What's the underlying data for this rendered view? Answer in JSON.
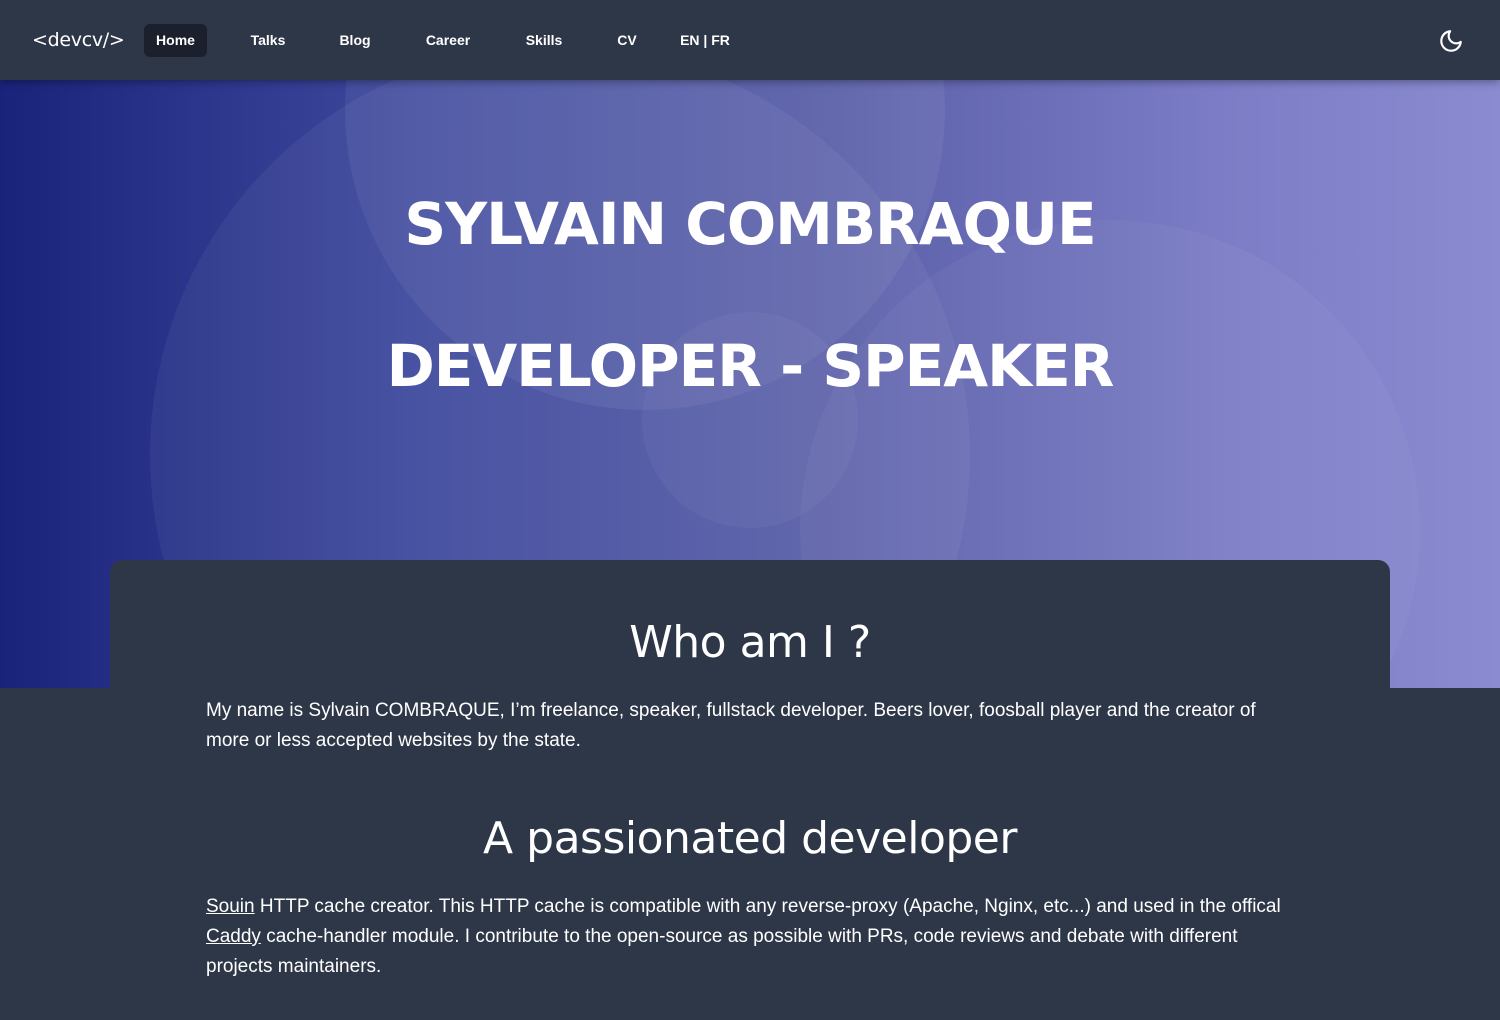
{
  "header": {
    "logo": "<devcv/>",
    "nav": [
      {
        "label": "Home",
        "active": true
      },
      {
        "label": "Talks"
      },
      {
        "label": "Blog"
      },
      {
        "label": "Career"
      },
      {
        "label": "Skills"
      },
      {
        "label": "CV"
      },
      {
        "label": "EN | FR"
      }
    ],
    "theme_icon": "moon-icon"
  },
  "hero": {
    "title_line1": "SYLVAIN COMBRAQUE",
    "title_line2": "DEVELOPER - SPEAKER"
  },
  "about": {
    "title": "Who am I ?",
    "text": "My name is Sylvain COMBRAQUE, I’m freelance, speaker, fullstack developer. Beers lover, foosball player and the creator of more or less accepted websites by the state."
  },
  "passion": {
    "title": "A passionated developer",
    "link_souin": "Souin",
    "text_part1": " HTTP cache creator. This HTTP cache is compatible with any reverse-proxy (Apache, Nginx, etc...) and used in the offical ",
    "link_caddy": "Caddy",
    "text_part2": " cache-handler module. I contribute to the open-source as possible with PRs, code reviews and debate with different projects maintainers."
  },
  "colors": {
    "background": "#2e3748",
    "active_nav": "#1b202c",
    "hero_start": "#1a237a",
    "hero_end": "#8a8bd0"
  }
}
